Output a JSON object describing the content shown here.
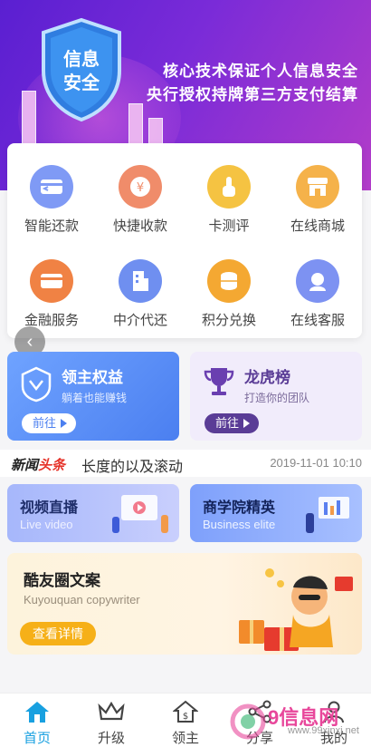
{
  "banner": {
    "line1": "核心技术保证个人信息安全",
    "line2": "央行授权持牌第三方支付结算",
    "shield_text_top": "信息",
    "shield_text_bottom": "安全"
  },
  "grid": [
    {
      "label": "智能还款",
      "icon": "card-return-icon",
      "color": "#7f9af5"
    },
    {
      "label": "快捷收款",
      "icon": "yen-coin-icon",
      "color": "#f08c6a"
    },
    {
      "label": "卡测评",
      "icon": "tap-finger-icon",
      "color": "#f5c342"
    },
    {
      "label": "在线商城",
      "icon": "store-icon",
      "color": "#f5b24a"
    },
    {
      "label": "金融服务",
      "icon": "credit-card-icon",
      "color": "#f08244"
    },
    {
      "label": "中介代还",
      "icon": "building-icon",
      "color": "#6f8ff0"
    },
    {
      "label": "积分兑换",
      "icon": "coin-stack-icon",
      "color": "#f4a832"
    },
    {
      "label": "在线客服",
      "icon": "headset-icon",
      "color": "#7d92f2"
    }
  ],
  "promo": {
    "left": {
      "title": "领主权益",
      "subtitle": "躺着也能赚钱",
      "button": "前往",
      "bg": "#5b8ff5"
    },
    "right": {
      "title": "龙虎榜",
      "subtitle": "打造你的团队",
      "button": "前往",
      "bg": "#f1ecfb"
    }
  },
  "news": {
    "tag_a": "新闻",
    "tag_b": "头条",
    "message": "长度的以及滚动",
    "date": "2019-11-01 10:10"
  },
  "features": {
    "left": {
      "title": "视频直播",
      "subtitle": "Live video"
    },
    "right": {
      "title": "商学院精英",
      "subtitle": "Business elite"
    }
  },
  "copywriter": {
    "title": "酷友圈文案",
    "subtitle": "Kuyouquan copywriter",
    "button": "查看详情"
  },
  "tabs": [
    {
      "label": "首页",
      "icon": "home-icon",
      "active": true
    },
    {
      "label": "升级",
      "icon": "crown-icon",
      "active": false
    },
    {
      "label": "领主",
      "icon": "money-house-icon",
      "active": false
    },
    {
      "label": "分享",
      "icon": "share-icon",
      "active": false
    },
    {
      "label": "我的",
      "icon": "person-icon",
      "active": false
    }
  ],
  "watermark": {
    "title": "9信息网",
    "url": "www.99xinxi.net"
  },
  "colors": {
    "accent": "#18a0e0",
    "banner_start": "#5a1fd1",
    "banner_end": "#b23cc9"
  }
}
